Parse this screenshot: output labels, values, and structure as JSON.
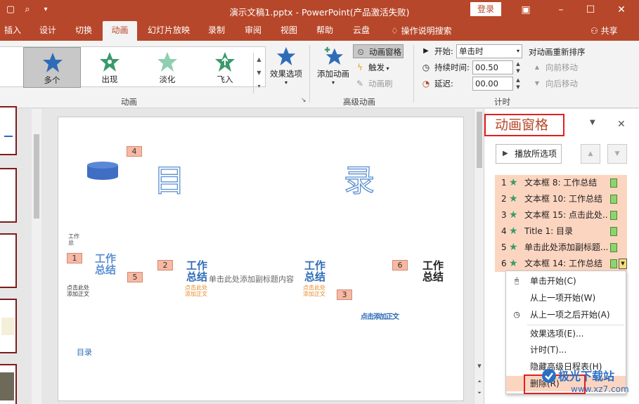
{
  "titlebar": {
    "title": "演示文稿1.pptx  -  PowerPoint(产品激活失败)",
    "login_label": "登录",
    "quick_access": [
      "save-icon",
      "preview-icon",
      "customize-icon"
    ]
  },
  "tabs": [
    "插入",
    "设计",
    "切换",
    "动画",
    "幻灯片放映",
    "录制",
    "审阅",
    "视图",
    "帮助",
    "云盘"
  ],
  "active_tab": "动画",
  "tellme_label": "操作说明搜索",
  "share_label": "共享",
  "ribbon": {
    "animations": {
      "items": [
        "多个",
        "出现",
        "淡化",
        "飞入"
      ],
      "selected": "多个",
      "effect_options_label": "效果选项",
      "group_label": "动画"
    },
    "advanced": {
      "add_animation_label": "添加动画",
      "animation_pane_label": "动画窗格",
      "trigger_label": "触发",
      "painter_label": "动画刷",
      "group_label": "高级动画"
    },
    "timing": {
      "start_label": "开始:",
      "start_value": "单击时",
      "duration_label": "持续时间:",
      "duration_value": "00.50",
      "delay_label": "延迟:",
      "delay_value": "00.00",
      "reorder_label": "对动画重新排序",
      "move_earlier_label": "向前移动",
      "move_later_label": "向后移动",
      "group_label": "计时"
    }
  },
  "slide": {
    "title_left": "目",
    "title_right": "录",
    "subtitle": "单击此处添加副标题内容",
    "wordart": "工作总结",
    "body_hint": "点击此处添加正文",
    "toc_label": "目录",
    "corner_note": "点击添加正文",
    "tiny_note": "工作总",
    "badges": [
      "4",
      "1",
      "5",
      "2",
      "3",
      "6"
    ]
  },
  "pane": {
    "title": "动画窗格",
    "play_label": "播放所选项",
    "items": [
      {
        "num": "1",
        "name": "文本框 8: 工作总结"
      },
      {
        "num": "2",
        "name": "文本框 10: 工作总结"
      },
      {
        "num": "3",
        "name": "文本框 15: 点击此处..."
      },
      {
        "num": "4",
        "name": "Title 1:  目录"
      },
      {
        "num": "5",
        "name": "单击此处添加副标题..."
      },
      {
        "num": "6",
        "name": "文本框 14: 工作总结"
      }
    ]
  },
  "context_menu": {
    "items": [
      "单击开始(C)",
      "从上一项开始(W)",
      "从上一项之后开始(A)",
      "效果选项(E)...",
      "计时(T)...",
      "隐藏高级日程表(H)",
      "删除(R)"
    ]
  },
  "watermark": {
    "title": "极光下载站",
    "url": "www.xz7.com"
  },
  "colors": {
    "brand": "#b7472a",
    "highlight": "#fcd5c0",
    "callout": "#e02020"
  }
}
